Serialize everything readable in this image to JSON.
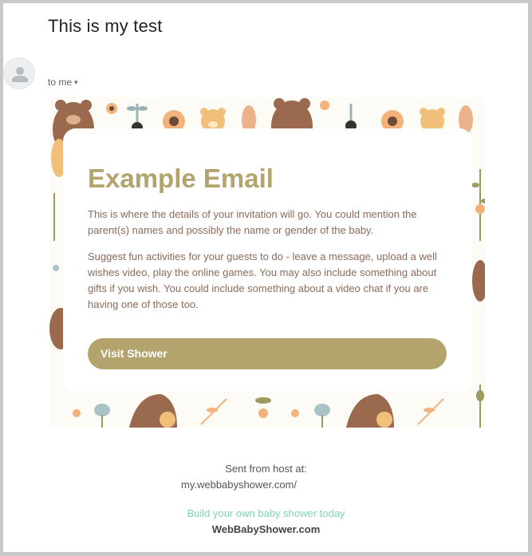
{
  "email": {
    "subject": "This is my test",
    "recipient_label": "to me",
    "recipient_caret": "▾"
  },
  "card": {
    "title": "Example Email",
    "paragraph1": "This is where the details of your invitation will go. You could mention the parent(s) names and possibly the name or gender of the baby.",
    "paragraph2": "Suggest fun activities for your guests to do - leave a message, upload a well wishes video, play the online games. You may also include something about gifts if you wish. You could include something about a video chat if you are having one of those too.",
    "button_label": "Visit Shower"
  },
  "footer": {
    "sent_from": "Sent from host at:",
    "host_url": "my.webbabyshower.com/",
    "build_link": "Build your own baby shower today",
    "brand": "WebBabyShower.com"
  },
  "colors": {
    "accent": "#b2a46c",
    "body_text": "#8d6a5a",
    "link_green": "#7fd3b8",
    "bear_brown": "#9b6a4e",
    "flower_orange": "#f3b27a",
    "leaf_olive": "#9e9a5e",
    "bud_blue": "#a9c3c6"
  },
  "icons": {
    "avatar": "person-icon",
    "caret": "chevron-down-icon",
    "pattern": [
      "bear-icon",
      "flower-icon",
      "leaf-icon",
      "bud-icon",
      "dot-icon"
    ]
  }
}
